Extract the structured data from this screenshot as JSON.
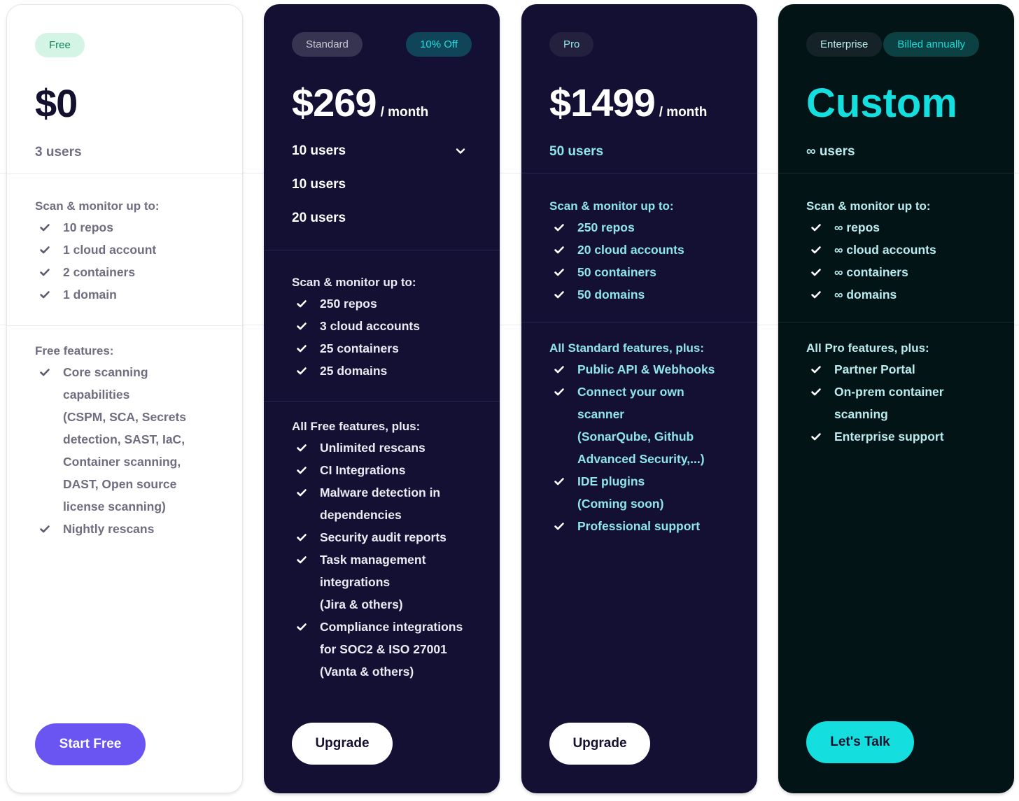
{
  "colors": {
    "free_card_bg": "#ffffff",
    "standard_card_bg": "#141033",
    "pro_card_bg": "#141033",
    "enterprise_card_bg": "#021416",
    "accent_purple": "#6a55f2",
    "accent_cyan": "#15dede"
  },
  "plans": {
    "free": {
      "badge": "Free",
      "price": "$0",
      "users": "3 users",
      "limits_title": "Scan & monitor up to:",
      "limits": [
        "10 repos",
        "1 cloud account",
        "2 containers",
        "1 domain"
      ],
      "features_title": "Free features:",
      "features": [
        "Core scanning\ncapabilities\n(CSPM, SCA, Secrets\ndetection, SAST, IaC,\nContainer scanning,\nDAST, Open source\nlicense scanning)",
        "Nightly rescans"
      ],
      "cta": "Start Free"
    },
    "standard": {
      "badge": "Standard",
      "discount_badge": "10% Off",
      "price": "$269",
      "period": "/ month",
      "users_select": {
        "selected": "10 users",
        "icon": "chevron-down-icon",
        "options": [
          "10 users",
          "20 users"
        ]
      },
      "limits_title": "Scan & monitor up to:",
      "limits": [
        "250 repos",
        "3 cloud accounts",
        "25 containers",
        "25 domains"
      ],
      "features_title": "All Free features, plus:",
      "features": [
        "Unlimited rescans",
        "CI Integrations",
        "Malware detection in\ndependencies",
        "Security audit reports",
        "Task management\nintegrations\n(Jira & others)",
        "Compliance integrations\nfor SOC2 & ISO 27001\n(Vanta & others)"
      ],
      "cta": "Upgrade"
    },
    "pro": {
      "badge": "Pro",
      "price": "$1499",
      "period": "/ month",
      "users": "50 users",
      "limits_title": "Scan & monitor up to:",
      "limits": [
        "250 repos",
        "20 cloud accounts",
        "50 containers",
        "50 domains"
      ],
      "features_title": "All Standard features, plus:",
      "features": [
        "Public API & Webhooks",
        "Connect your own\nscanner\n(SonarQube,  Github\nAdvanced Security,...)",
        "IDE plugins\n(Coming soon)",
        "Professional support"
      ],
      "cta": "Upgrade"
    },
    "enterprise": {
      "badge": "Enterprise",
      "billing_badge": "Billed annually",
      "price": "Custom",
      "users": "∞ users",
      "limits_title": "Scan & monitor up to:",
      "limits": [
        "∞ repos",
        "∞ cloud accounts",
        "∞ containers",
        "∞ domains"
      ],
      "features_title": "All Pro features, plus:",
      "features": [
        "Partner Portal",
        "On-prem container\nscanning",
        "Enterprise support"
      ],
      "cta": "Let's Talk"
    }
  }
}
